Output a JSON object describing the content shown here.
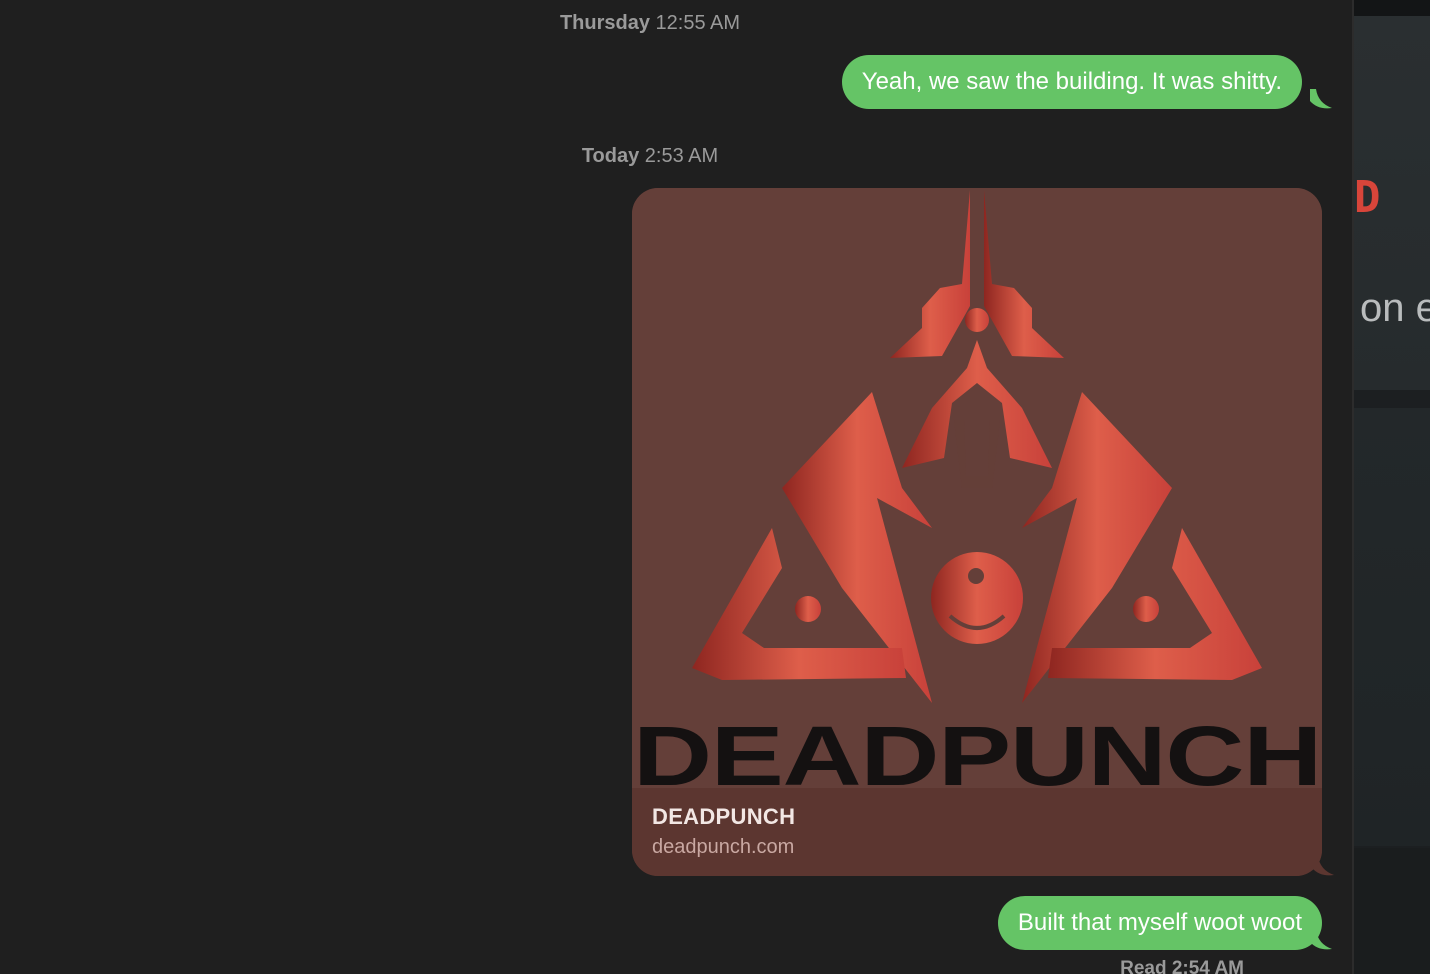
{
  "conversation": {
    "timestamps": [
      {
        "day": "Thursday",
        "time": "12:55 AM"
      },
      {
        "day": "Today",
        "time": "2:53 AM"
      }
    ],
    "messages": [
      {
        "text": "Yeah, we saw the building. It was shitty."
      },
      {
        "text": "Built that myself woot woot"
      }
    ],
    "link_preview": {
      "logo_wordmark": "DEADPUNCH",
      "title": "DEADPUNCH",
      "domain": "deadpunch.com"
    },
    "read_receipt": "Read 2:54 AM"
  },
  "background_window": {
    "red_text": "D C",
    "gray_text": "on e"
  },
  "colors": {
    "bubble_green": "#65c466",
    "background": "#1f1f1f",
    "timestamp_gray": "#9a9a9a",
    "logo_red": "#d4483c",
    "card_bg": "#643f39"
  }
}
